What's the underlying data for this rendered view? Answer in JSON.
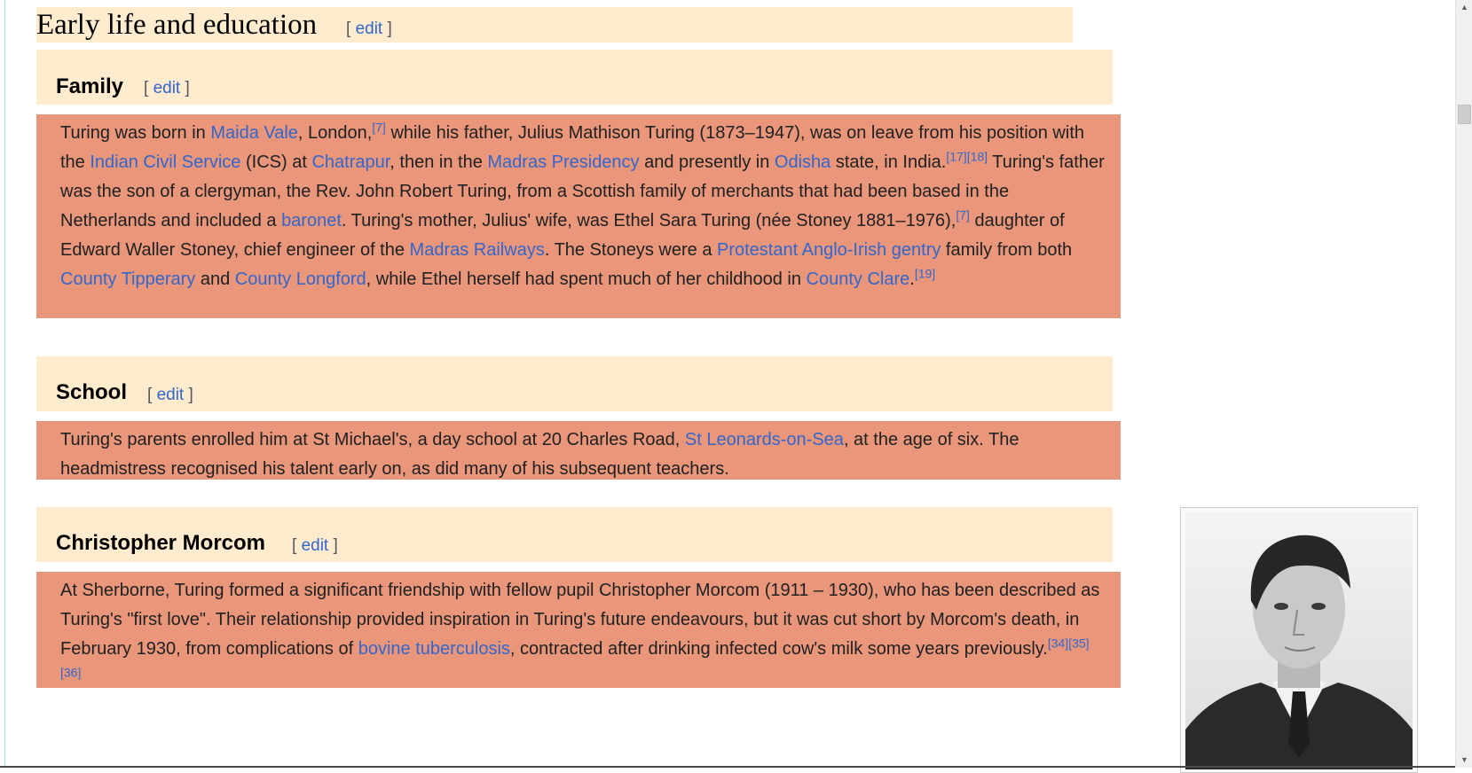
{
  "section": {
    "title": "Early life and education",
    "edit": {
      "open": "[ ",
      "label": "edit",
      "close": " ]"
    }
  },
  "family": {
    "title": "Family",
    "edit": {
      "open": "[ ",
      "label": "edit",
      "close": " ]"
    },
    "t1": "Turing was born in ",
    "l_maida": "Maida Vale",
    "t2": ", London,",
    "r7a": "[7]",
    "t3": " while his father, Julius Mathison Turing (1873–1947), was on leave from his position with the ",
    "l_ics": "Indian Civil Service",
    "t4": " (ICS) at ",
    "l_chatrapur": "Chatrapur",
    "t5": ", then in the ",
    "l_madras_pres": "Madras Presidency",
    "t6": " and presently in ",
    "l_odisha": "Odisha",
    "t7": " state, in India.",
    "r17": "[17]",
    "r18": "[18]",
    "t8": " Turing's father was the son of a clergyman, the Rev. John Robert Turing, from a Scottish family of merchants that had been based in the Netherlands and included a ",
    "l_baronet": "baronet",
    "t9": ". Turing's mother, Julius' wife, was Ethel Sara Turing (née Stoney 1881–1976),",
    "r7b": "[7]",
    "t10": " daughter of Edward Waller Stoney, chief engineer of the ",
    "l_madras_rail": "Madras Railways",
    "t11": ". The Stoneys were a ",
    "l_gentry": "Protestant Anglo-Irish gentry",
    "t12": " family from both ",
    "l_tipperary": "County Tipperary",
    "t13": " and ",
    "l_longford": "County Longford",
    "t14": ", while Ethel herself had spent much of her childhood in ",
    "l_clare": "County Clare",
    "t15": ".",
    "r19": "[19]"
  },
  "school": {
    "title": "School",
    "edit": {
      "open": "[ ",
      "label": "edit",
      "close": " ]"
    },
    "t1": "Turing's parents enrolled him at St Michael's, a day school at 20 Charles Road, ",
    "l_leonards": "St Leonards-on-Sea",
    "t2": ", at the age of six. The headmistress recognised his talent early on, as did many of his subsequent teachers."
  },
  "morcom": {
    "title": "Christopher Morcom",
    "edit": {
      "open": "[ ",
      "label": "edit",
      "close": " ]"
    },
    "t1": "At Sherborne, Turing formed a significant friendship with fellow pupil Christopher Morcom (1911 – 1930), who has been described as Turing's \"first love\". Their relationship provided inspiration in Turing's future endeavours, but it was cut short by Morcom's death, in February 1930, from complications of ",
    "l_tb": "bovine tuberculosis",
    "t2": ", contracted after drinking infected cow's milk some years previously.",
    "r34": "[34]",
    "r35": "[35]",
    "r36": "[36]"
  },
  "scrollbar": {
    "up": "▲",
    "down": "▼"
  },
  "colors": {
    "heading_bg": "#ffebcd",
    "paragraph_bg": "#e9967a",
    "link": "#3366cc"
  }
}
